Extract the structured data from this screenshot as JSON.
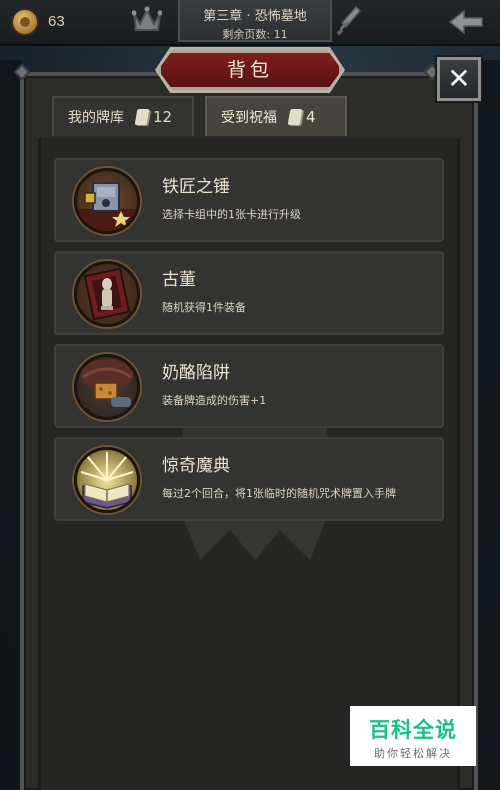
{
  "topbar": {
    "gold": "63",
    "chapter_title": "第三章 · 恐怖墓地",
    "pages_left": "剩余页数: 11"
  },
  "panel": {
    "title": "背包",
    "close_label": "✕"
  },
  "tabs": [
    {
      "label": "我的牌库",
      "count": "12"
    },
    {
      "label": "受到祝福",
      "count": "4"
    }
  ],
  "items": [
    {
      "name": "铁匠之锤",
      "desc": "选择卡组中的1张卡进行升级",
      "icon": "anvil-icon"
    },
    {
      "name": "古董",
      "desc": "随机获得1件装备",
      "icon": "antique-icon"
    },
    {
      "name": "奶酪陷阱",
      "desc": "装备牌造成的伤害+1",
      "icon": "cheese-trap-icon"
    },
    {
      "name": "惊奇魔典",
      "desc": "每过2个回合，将1张临时的随机咒术牌置入手牌",
      "icon": "spellbook-icon"
    }
  ],
  "watermark": {
    "main": "百科全说",
    "sub": "助你轻松解决"
  },
  "colors": {
    "banner_red": "#6a1616",
    "panel_bg": "#2b2b28",
    "item_bg": "#333331",
    "watermark_green": "#1bbf8a"
  }
}
